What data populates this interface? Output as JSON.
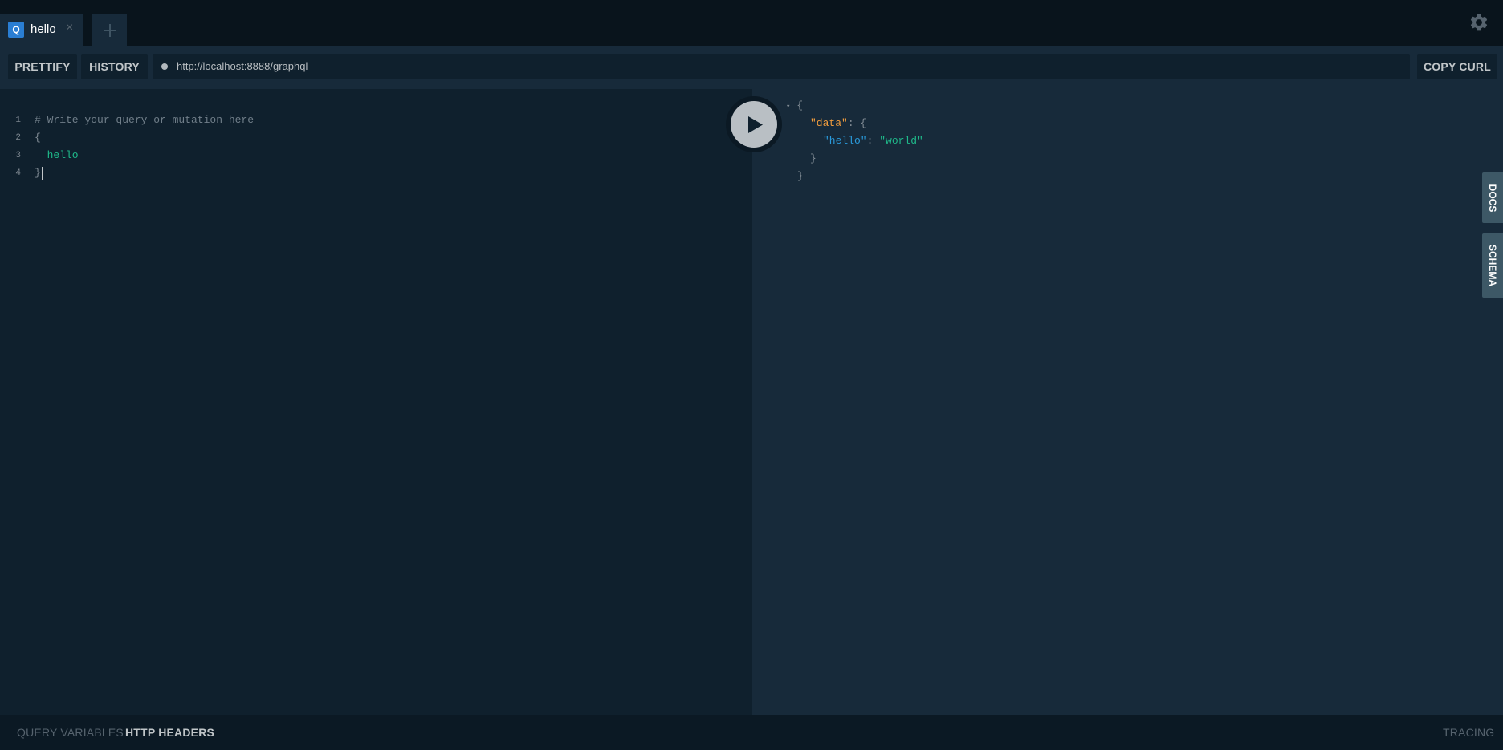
{
  "tabs": [
    {
      "badge": "Q",
      "title": "hello",
      "close": "×"
    }
  ],
  "toolbar": {
    "prettify_label": "PRETTIFY",
    "history_label": "HISTORY",
    "endpoint_url": "http://localhost:8888/graphql",
    "copy_curl_label": "COPY CURL"
  },
  "editor": {
    "lines": [
      {
        "num": "1",
        "text": "# Write your query or mutation here"
      },
      {
        "num": "2",
        "text": "{"
      },
      {
        "num": "3",
        "text": "  hello"
      },
      {
        "num": "4",
        "text": "}"
      }
    ]
  },
  "result": {
    "open_brace": "{",
    "data_key": "\"data\"",
    "colon": ": ",
    "inner_open": "{",
    "hello_key": "\"hello\"",
    "hello_value": "\"world\"",
    "inner_close": "}",
    "close_brace": "}",
    "fold_marker": "▾"
  },
  "side_tabs": {
    "docs_label": "DOCS",
    "schema_label": "SCHEMA"
  },
  "bottom": {
    "query_variables_label": "QUERY VARIABLES",
    "http_headers_label": "HTTP HEADERS",
    "tracing_label": "TRACING"
  },
  "icons": {
    "add_tab": "plus-icon",
    "settings": "gear-icon",
    "run": "play-icon"
  },
  "colors": {
    "badge": "#2a7ed3",
    "json_key_outer": "#f29d3d",
    "json_key_inner": "#2a9bdc",
    "json_string": "#1fb98a",
    "field": "#1fb98a"
  }
}
